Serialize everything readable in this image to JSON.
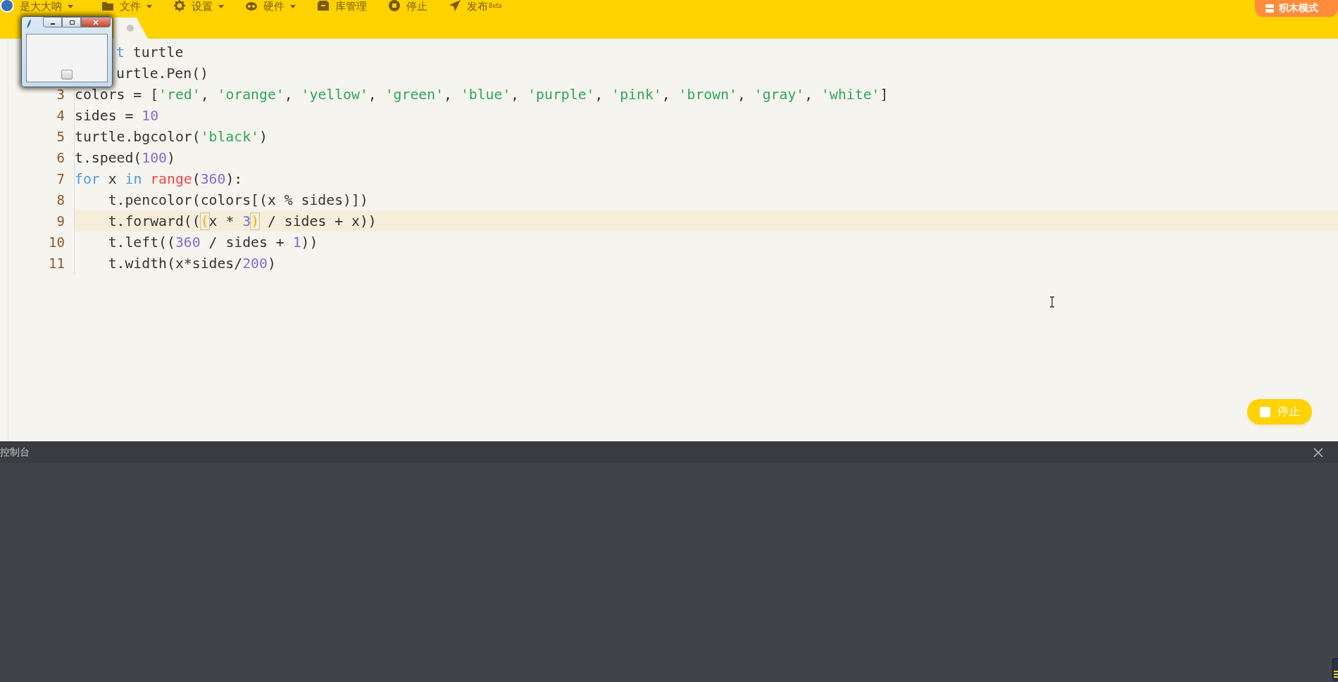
{
  "menu": {
    "user": {
      "label": "是大大呐",
      "dropdown": true
    },
    "items": [
      {
        "label": "文件",
        "kind": "file",
        "dropdown": true
      },
      {
        "label": "设置",
        "kind": "settings",
        "dropdown": true
      },
      {
        "label": "硬件",
        "kind": "hardware",
        "dropdown": true
      },
      {
        "label": "库管理",
        "kind": "library",
        "dropdown": false
      },
      {
        "label": "停止",
        "kind": "stop",
        "dropdown": false
      },
      {
        "label": "发布",
        "sup": "Beta",
        "kind": "publish",
        "dropdown": false
      }
    ],
    "mode_button": "积木模式"
  },
  "tab": {
    "unsaved": true
  },
  "editor": {
    "lines": [
      {
        "covered": true,
        "current": false,
        "tokens": [
          {
            "kind": "keyword",
            "text": "t"
          },
          {
            "kind": "plain",
            "text": " turtle"
          }
        ]
      },
      {
        "covered": true,
        "current": false,
        "tokens": [
          {
            "kind": "plain",
            "text": "urtle.Pen()"
          }
        ]
      },
      {
        "number": "3",
        "covered": false,
        "current": false,
        "tokens": [
          {
            "kind": "plain",
            "text": "colors = ["
          },
          {
            "kind": "string",
            "text": "'red'"
          },
          {
            "kind": "plain",
            "text": ", "
          },
          {
            "kind": "string",
            "text": "'orange'"
          },
          {
            "kind": "plain",
            "text": ", "
          },
          {
            "kind": "string",
            "text": "'yellow'"
          },
          {
            "kind": "plain",
            "text": ", "
          },
          {
            "kind": "string",
            "text": "'green'"
          },
          {
            "kind": "plain",
            "text": ", "
          },
          {
            "kind": "string",
            "text": "'blue'"
          },
          {
            "kind": "plain",
            "text": ", "
          },
          {
            "kind": "string",
            "text": "'purple'"
          },
          {
            "kind": "plain",
            "text": ", "
          },
          {
            "kind": "string",
            "text": "'pink'"
          },
          {
            "kind": "plain",
            "text": ", "
          },
          {
            "kind": "string",
            "text": "'brown'"
          },
          {
            "kind": "plain",
            "text": ", "
          },
          {
            "kind": "string",
            "text": "'gray'"
          },
          {
            "kind": "plain",
            "text": ", "
          },
          {
            "kind": "string",
            "text": "'white'"
          },
          {
            "kind": "plain",
            "text": "]"
          }
        ]
      },
      {
        "number": "4",
        "covered": false,
        "current": false,
        "tokens": [
          {
            "kind": "plain",
            "text": "sides = "
          },
          {
            "kind": "number",
            "text": "10"
          }
        ]
      },
      {
        "number": "5",
        "covered": false,
        "current": false,
        "tokens": [
          {
            "kind": "plain",
            "text": "turtle.bgcolor("
          },
          {
            "kind": "string",
            "text": "'black'"
          },
          {
            "kind": "plain",
            "text": ")"
          }
        ]
      },
      {
        "number": "6",
        "covered": false,
        "current": false,
        "tokens": [
          {
            "kind": "plain",
            "text": "t.speed("
          },
          {
            "kind": "number",
            "text": "100"
          },
          {
            "kind": "plain",
            "text": ")"
          }
        ]
      },
      {
        "number": "7",
        "covered": false,
        "current": false,
        "tokens": [
          {
            "kind": "keyword",
            "text": "for"
          },
          {
            "kind": "plain",
            "text": " x "
          },
          {
            "kind": "keyword",
            "text": "in "
          },
          {
            "kind": "builtin",
            "text": "range"
          },
          {
            "kind": "plain",
            "text": "("
          },
          {
            "kind": "number",
            "text": "360"
          },
          {
            "kind": "plain",
            "text": "):"
          }
        ]
      },
      {
        "number": "8",
        "covered": false,
        "current": false,
        "tokens": [
          {
            "kind": "plain",
            "text": "    t.pencolor(colors[(x % sides)])"
          }
        ]
      },
      {
        "number": "9",
        "covered": false,
        "current": true,
        "tokens": [
          {
            "kind": "plain",
            "text": "    t.forward(("
          },
          {
            "kind": "match",
            "text": "("
          },
          {
            "kind": "plain",
            "text": "x * "
          },
          {
            "kind": "number",
            "text": "3"
          },
          {
            "kind": "match",
            "text": ")"
          },
          {
            "kind": "plain",
            "text": " / sides + x))"
          }
        ]
      },
      {
        "number": "10",
        "covered": false,
        "current": false,
        "tokens": [
          {
            "kind": "plain",
            "text": "    t.left(("
          },
          {
            "kind": "number",
            "text": "360"
          },
          {
            "kind": "plain",
            "text": " / sides + "
          },
          {
            "kind": "number",
            "text": "1"
          },
          {
            "kind": "plain",
            "text": "))"
          }
        ]
      },
      {
        "number": "11",
        "covered": false,
        "current": false,
        "tokens": [
          {
            "kind": "plain",
            "text": "    t.width(x*sides/"
          },
          {
            "kind": "number",
            "text": "200"
          },
          {
            "kind": "plain",
            "text": ")"
          }
        ]
      }
    ]
  },
  "stop_button": "停止",
  "console": {
    "title": "控制台"
  }
}
